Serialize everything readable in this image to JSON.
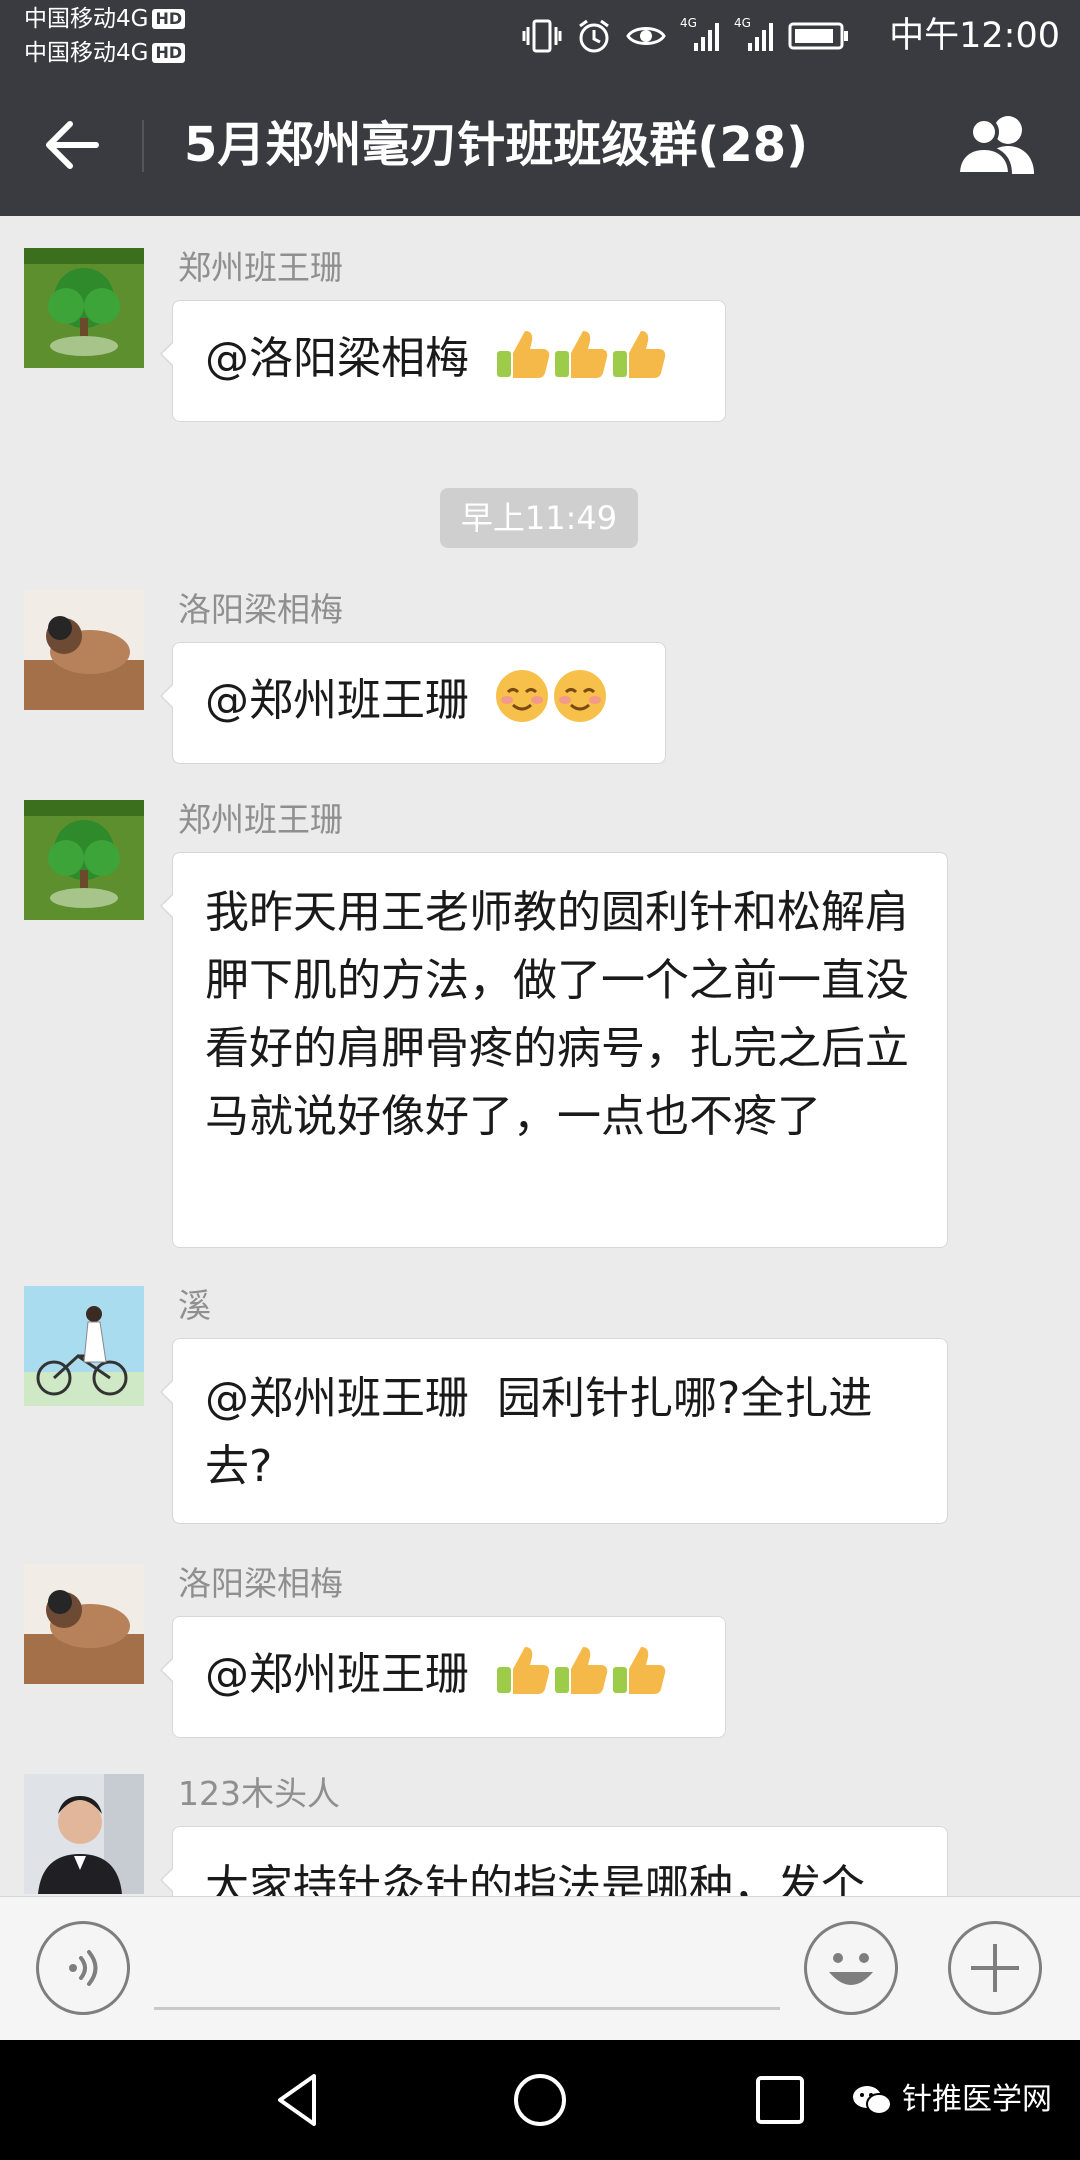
{
  "status_bar": {
    "carrier_1": "中国移动4G",
    "carrier_2": "中国移动4G",
    "hd_badge": "HD",
    "network_1": "4G",
    "network_2": "4G",
    "time": "中午12:00"
  },
  "header": {
    "title": "5月郑州毫刃针班班级群(28)"
  },
  "messages": [
    {
      "sender": "郑州班王珊",
      "text": "@洛阳梁相梅",
      "emoji": [
        "thumbs-up",
        "thumbs-up",
        "thumbs-up"
      ],
      "avatar_icon": "tree-avatar"
    },
    {
      "sender": "洛阳梁相梅",
      "text": "@郑州班王珊",
      "emoji": [
        "smiling-face",
        "smiling-face"
      ],
      "avatar_icon": "person-avatar"
    },
    {
      "sender": "郑州班王珊",
      "text": "我昨天用王老师教的圆利针和松解肩胛下肌的方法，做了一个之前一直没看好的肩胛骨疼的病号，扎完之后立马就说好像好了，一点也不疼了",
      "avatar_icon": "tree-avatar"
    },
    {
      "sender": "溪",
      "text": "@郑州班王珊  园利针扎哪?全扎进去?",
      "avatar_icon": "bicycle-avatar"
    },
    {
      "sender": "洛阳梁相梅",
      "text": "@郑州班王珊",
      "emoji": [
        "thumbs-up",
        "thumbs-up",
        "thumbs-up"
      ],
      "avatar_icon": "person-avatar"
    },
    {
      "sender": "123木头人",
      "text": "大家持针灸针的指法是哪种，发个",
      "avatar_icon": "man-avatar"
    }
  ],
  "timestamp": "早上11:49",
  "watermark": "针推医学网",
  "colors": {
    "title_bar": "#3a3b40",
    "chat_background": "#ebebeb",
    "bubble": "#ffffff",
    "sender_name": "#8f8f8f"
  }
}
